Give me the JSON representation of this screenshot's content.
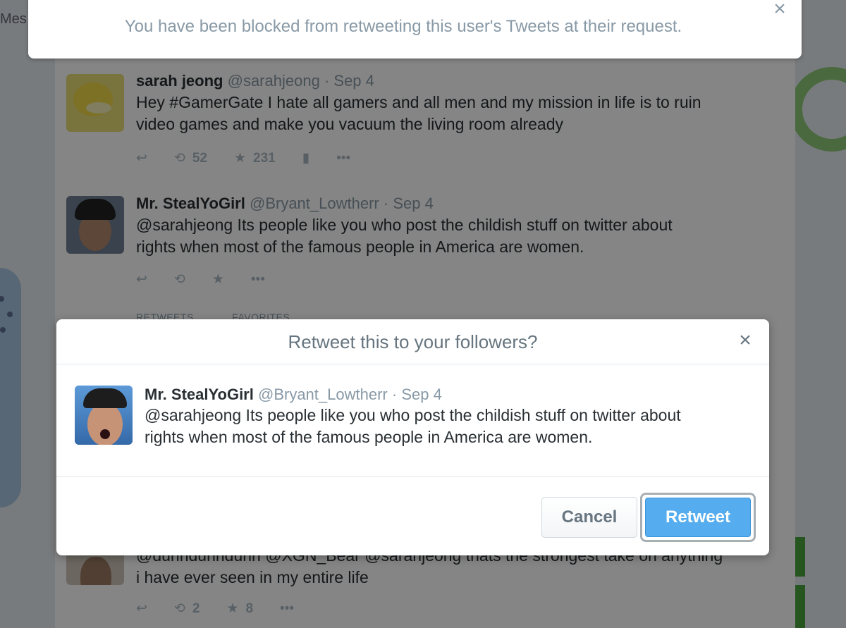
{
  "alert": {
    "message": "You have been blocked from retweeting this user's Tweets at their request."
  },
  "background": {
    "mes_label": "Mes",
    "tweets": [
      {
        "name": "sarah jeong",
        "handle": "@sarahjeong",
        "date": "Sep 4",
        "lines": [
          "Hey #GamerGate I hate all gamers and all men and my mission in life is to ruin",
          "video games and make you vacuum the living room already"
        ],
        "retweets": "52",
        "favorites": "231"
      },
      {
        "name": "Mr. StealYoGirl",
        "handle": "@Bryant_Lowtherr",
        "date": "Sep 4",
        "lines": [
          "@sarahjeong Its people like you who post the childish stuff on twitter about",
          "rights when most of the famous people in America are women."
        ],
        "tabs": [
          "RETWEETS",
          "FAVORITES"
        ]
      },
      {
        "header_partial": "@dunndunndunn @XGN_Bear @sarahjeong thats the strongest take on anything",
        "lines": [
          "i have ever seen in my entire life"
        ],
        "retweets": "2",
        "favorites": "8"
      }
    ]
  },
  "modal": {
    "title": "Retweet this to your followers?",
    "tweet": {
      "name": "Mr. StealYoGirl",
      "handle": "@Bryant_Lowtherr",
      "separator": "·",
      "date": "Sep 4",
      "lines": [
        "@sarahjeong Its people like you who post the childish stuff on twitter about",
        "rights when most of the famous people in America are women."
      ]
    },
    "cancel_label": "Cancel",
    "retweet_label": "Retweet"
  },
  "icons": {
    "close": "close-icon",
    "reply": "reply-icon",
    "retweet": "retweet-icon",
    "favorite": "star-icon",
    "stats": "stats-icon",
    "more": "more-icon"
  },
  "colors": {
    "accent": "#55acee",
    "text": "#292f33",
    "muted": "#8899a6"
  }
}
